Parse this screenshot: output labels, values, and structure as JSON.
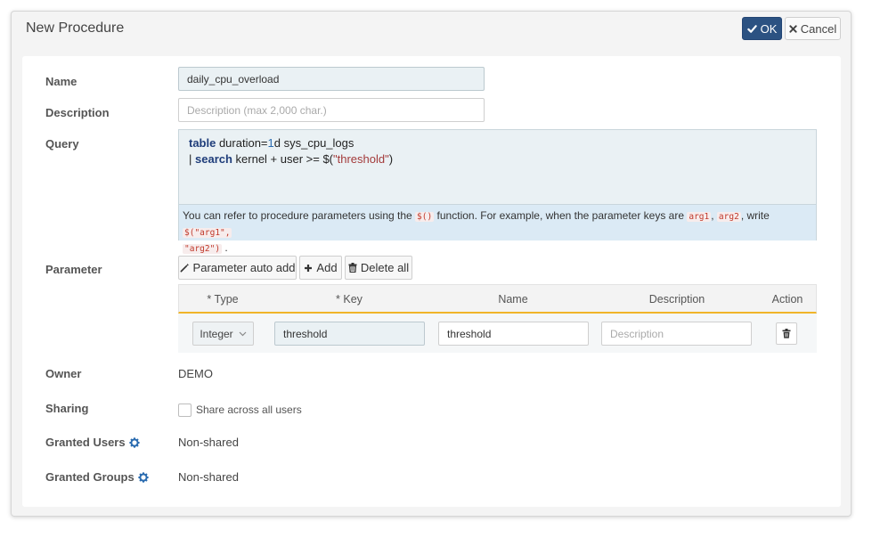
{
  "dialog": {
    "title": "New Procedure",
    "ok_label": "OK",
    "cancel_label": "Cancel"
  },
  "form": {
    "name_label": "Name",
    "name_value": "daily_cpu_overload",
    "description_label": "Description",
    "description_placeholder": "Description (max 2,000 char.)",
    "query_label": "Query",
    "query": {
      "line1_kw": "table",
      "line1_a": " duration=",
      "line1_num": "1",
      "line1_b": "d sys_cpu_logs",
      "line2_a": "| ",
      "line2_kw": "search",
      "line2_b": " kernel + user >= $(",
      "line2_str": "\"threshold\"",
      "line2_c": ")"
    },
    "hint": {
      "t1": "You can refer to procedure parameters using the ",
      "c1": "$()",
      "t2": " function. For example, when the parameter keys are ",
      "c2": "arg1",
      "t3": ", ",
      "c3": "arg2",
      "t4": ", write ",
      "c4": "$(\"arg1\",",
      "c5": "\"arg2\")",
      "t5": " ."
    },
    "parameter_label": "Parameter",
    "param_buttons": {
      "auto_add": "Parameter auto add",
      "add": "Add",
      "delete_all": "Delete all"
    },
    "param_table": {
      "headers": [
        "* Type",
        "* Key",
        "Name",
        "Description",
        "Action"
      ],
      "rows": [
        {
          "type": "Integer",
          "key": "threshold",
          "name": "threshold",
          "description_placeholder": "Description"
        }
      ]
    },
    "owner_label": "Owner",
    "owner_value": "DEMO",
    "sharing_label": "Sharing",
    "sharing_checkbox_label": "Share across all users",
    "sharing_checked": false,
    "granted_users_label": "Granted Users",
    "granted_users_value": "Non-shared",
    "granted_groups_label": "Granted Groups",
    "granted_groups_value": "Non-shared"
  },
  "colors": {
    "ok_button": "#2c5282",
    "gear_icon": "#2b6cb0",
    "table_accent": "#f0b429"
  },
  "icons": [
    "check-icon",
    "close-icon",
    "magic-wand-icon",
    "plus-icon",
    "trash-icon",
    "gear-icon",
    "chevron-down-icon"
  ]
}
